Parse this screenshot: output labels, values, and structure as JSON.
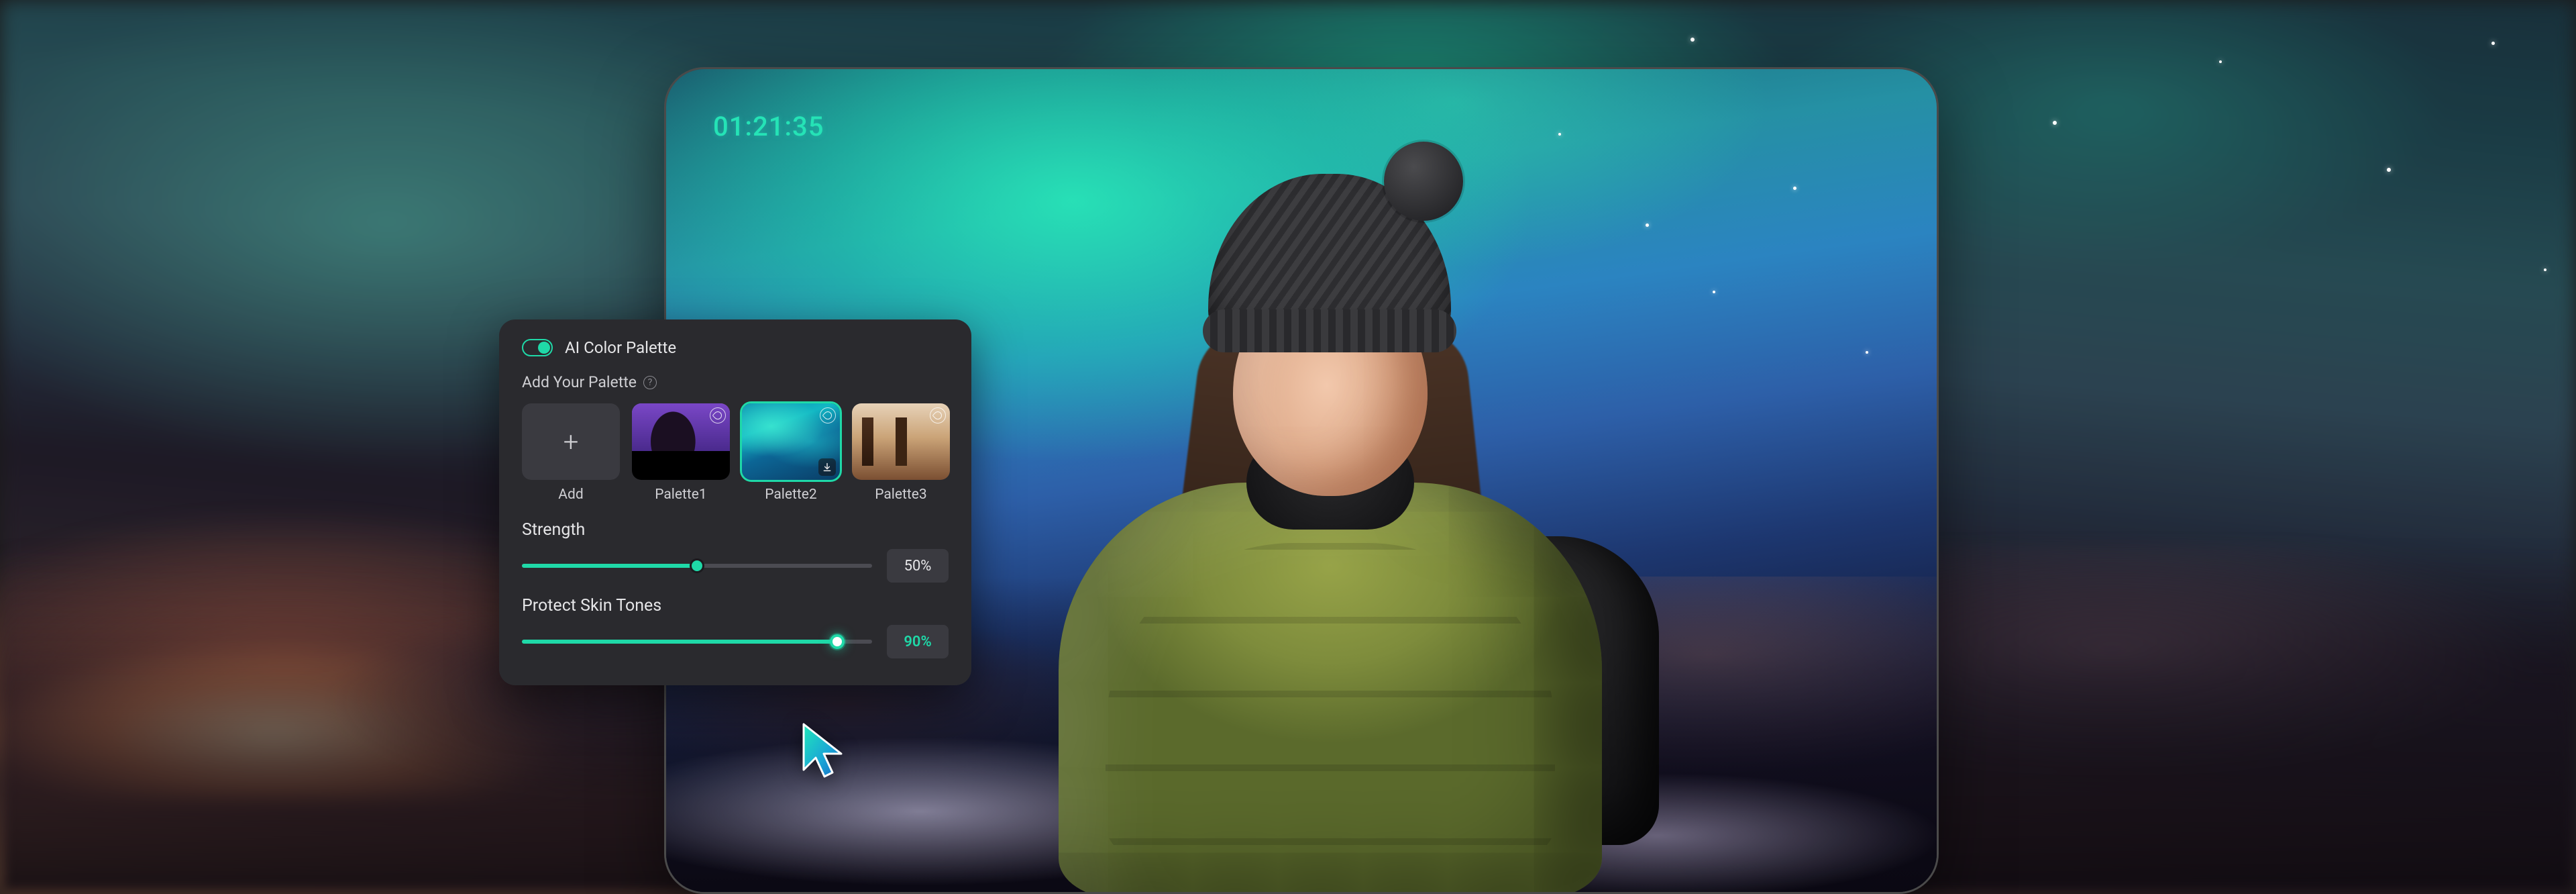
{
  "preview": {
    "timestamp": "01:21:35"
  },
  "panel": {
    "title": "AI Color Palette",
    "toggle_on": true,
    "add_palette_label": "Add Your Palette",
    "palettes": {
      "add_label": "Add",
      "items": [
        {
          "label": "Palette1"
        },
        {
          "label": "Palette2",
          "selected": true
        },
        {
          "label": "Palette3"
        }
      ]
    },
    "strength": {
      "label": "Strength",
      "value_text": "50%",
      "value_pct": 50
    },
    "protect_skin": {
      "label": "Protect Skin Tones",
      "value_text": "90%",
      "value_pct": 90
    }
  },
  "colors": {
    "accent": "#1fd9a8",
    "panel_bg": "#2a2a2e"
  }
}
